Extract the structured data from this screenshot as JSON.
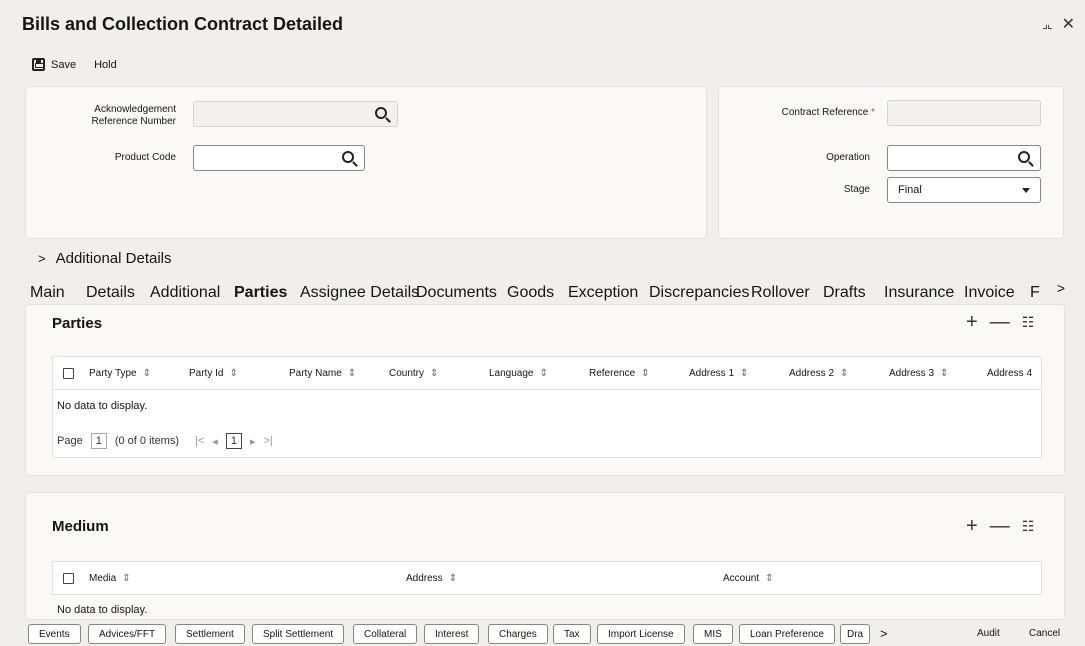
{
  "window": {
    "title": "Bills and Collection Contract Detailed"
  },
  "toolbar": {
    "save_label": "Save",
    "hold_label": "Hold"
  },
  "header": {
    "ack_ref_label": "Acknowledgement Reference Number",
    "ack_ref_value": "",
    "product_code_label": "Product Code",
    "product_code_value": "",
    "contract_ref_label": "Contract Reference",
    "contract_ref_required": "*",
    "contract_ref_value": "",
    "operation_label": "Operation",
    "operation_value": "",
    "stage_label": "Stage",
    "stage_value": "Final"
  },
  "additional_details": {
    "label": "Additional Details"
  },
  "tabs": [
    "Main",
    "Details",
    "Additional",
    "Parties",
    "Assignee Details",
    "Documents",
    "Goods",
    "Exception",
    "Discrepancies",
    "Rollover",
    "Drafts",
    "Insurance",
    "Invoice",
    "F"
  ],
  "active_tab": "Parties",
  "parties": {
    "title": "Parties",
    "columns": [
      "Party Type",
      "Party Id",
      "Party Name",
      "Country",
      "Language",
      "Reference",
      "Address 1",
      "Address 2",
      "Address 3",
      "Address 4"
    ],
    "empty_text": "No data to display.",
    "pager": {
      "page_label": "Page",
      "page_value": "1",
      "items_text": "(0 of 0 items)",
      "current_page": "1"
    }
  },
  "medium": {
    "title": "Medium",
    "columns": [
      "Media",
      "Address",
      "Account"
    ],
    "empty_text": "No data to display."
  },
  "bottom_bar": {
    "buttons": [
      "Events",
      "Advices/FFT",
      "Settlement",
      "Split Settlement",
      "Collateral",
      "Interest",
      "Charges",
      "Tax",
      "Import License",
      "MIS",
      "Loan Preference",
      "Dra"
    ],
    "audit_label": "Audit",
    "cancel_label": "Cancel"
  },
  "icons": {
    "add": "plus-icon",
    "remove": "minus-icon",
    "columns": "column-manager-icon",
    "search": "search-icon",
    "sort": "sort-icon"
  }
}
